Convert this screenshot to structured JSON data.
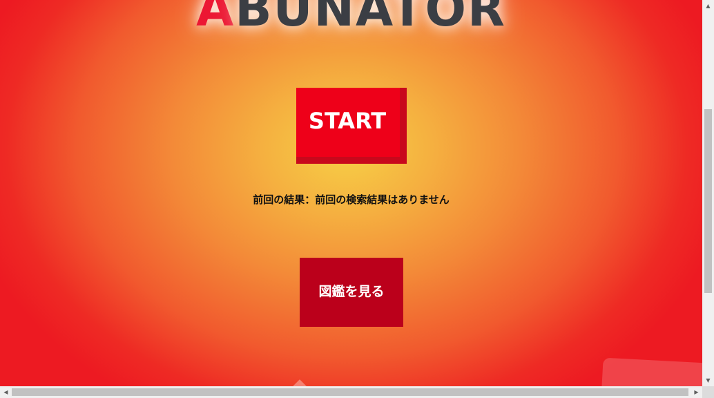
{
  "logo": {
    "first_letter": "A",
    "rest": "BUNATOR"
  },
  "start_button": {
    "label": "START"
  },
  "previous_result": {
    "text": "前回の結果：前回の検索結果はありません"
  },
  "zukan_button": {
    "label": "図鑑を見る"
  },
  "scrollbars": {
    "up_arrow": "▲",
    "down_arrow": "▼",
    "left_arrow": "◀",
    "right_arrow": "▶"
  },
  "colors": {
    "start_button": "#ee0019",
    "zukan_button": "#bb001b",
    "logo_accent": "#ec1733",
    "logo_text": "#3b3e44"
  }
}
